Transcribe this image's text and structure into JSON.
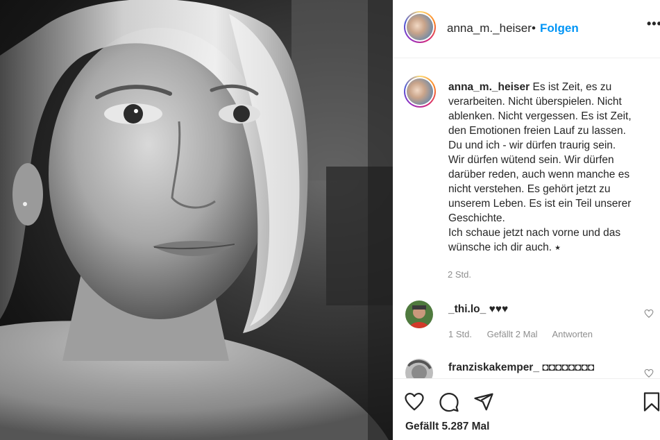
{
  "post": {
    "image_alt": "Schwarz-weiß Porträt einer Frau mit blondem Bob",
    "author": "anna_m._heiser",
    "separator": "•",
    "follow_label": "Folgen",
    "more_label": "•••",
    "caption_lines": [
      "Es ist Zeit, es zu",
      "verarbeiten. Nicht überspielen. Nicht",
      "ablenken. Nicht vergessen. Es ist Zeit,",
      "den Emotionen freien Lauf zu lassen.",
      "Du und ich - wir dürfen traurig sein.",
      "Wir dürfen wütend sein. Wir dürfen",
      "darüber reden, auch wenn manche es",
      "nicht verstehen. Es gehört jetzt zu",
      "unserem Leben. Es ist ein Teil unserer",
      "Geschichte.",
      "Ich schaue jetzt nach vorne und das",
      "wünsche ich dir auch. ⭑"
    ],
    "caption_time": "2 Std.",
    "likes": "Gefällt 5.287 Mal"
  },
  "comments": [
    {
      "username": "_thi.lo_",
      "text": "♥♥♥",
      "time": "1 Std.",
      "likes": "Gefällt 2 Mal",
      "reply": "Antworten"
    },
    {
      "username": "franziskakemper_",
      "text": "◘◘◘◘◘◘◘◘"
    }
  ],
  "icons": {
    "like": "heart-icon",
    "comment": "comment-bubble-icon",
    "share": "paper-plane-icon",
    "save": "bookmark-icon",
    "comment_like": "small-heart-icon"
  },
  "colors": {
    "link_blue": "#0095f6",
    "text": "#262626",
    "muted": "#8e8e8e",
    "divider": "#efefef"
  }
}
